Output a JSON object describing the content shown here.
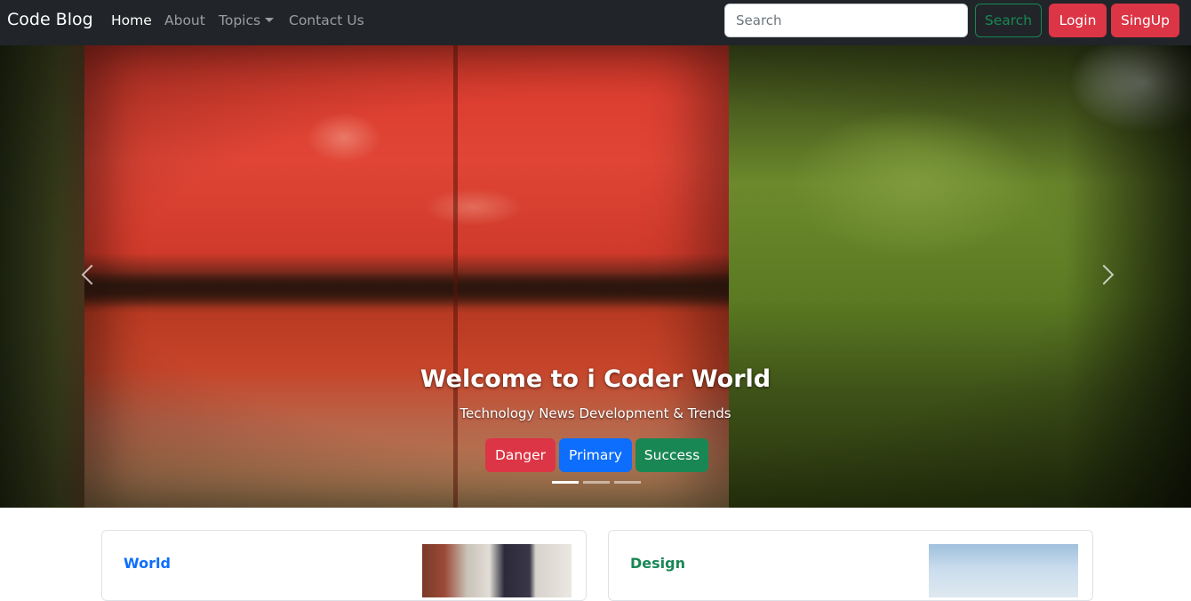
{
  "navbar": {
    "brand": "Code Blog",
    "links": [
      {
        "label": "Home",
        "active": true
      },
      {
        "label": "About",
        "active": false
      },
      {
        "label": "Topics",
        "active": false,
        "dropdown": true
      },
      {
        "label": "Contact Us",
        "active": false
      }
    ],
    "search": {
      "placeholder": "Search",
      "value": ""
    },
    "search_button": "Search",
    "login_button": "Login",
    "signup_button": "SingUp"
  },
  "carousel": {
    "title": "Welcome to i Coder World",
    "subtitle": "Technology News Development & Trends",
    "buttons": [
      "Danger",
      "Primary",
      "Success"
    ],
    "indicators": 3,
    "active_indicator": 0,
    "icons": {
      "prev": "chevron-left-icon",
      "next": "chevron-right-icon"
    }
  },
  "cards": [
    {
      "category": "World",
      "category_color": "#0d6efd"
    },
    {
      "category": "Design",
      "category_color": "#198754"
    }
  ],
  "colors": {
    "navbar_bg": "#212529",
    "danger": "#dc3545",
    "primary": "#0d6efd",
    "success": "#198754"
  }
}
